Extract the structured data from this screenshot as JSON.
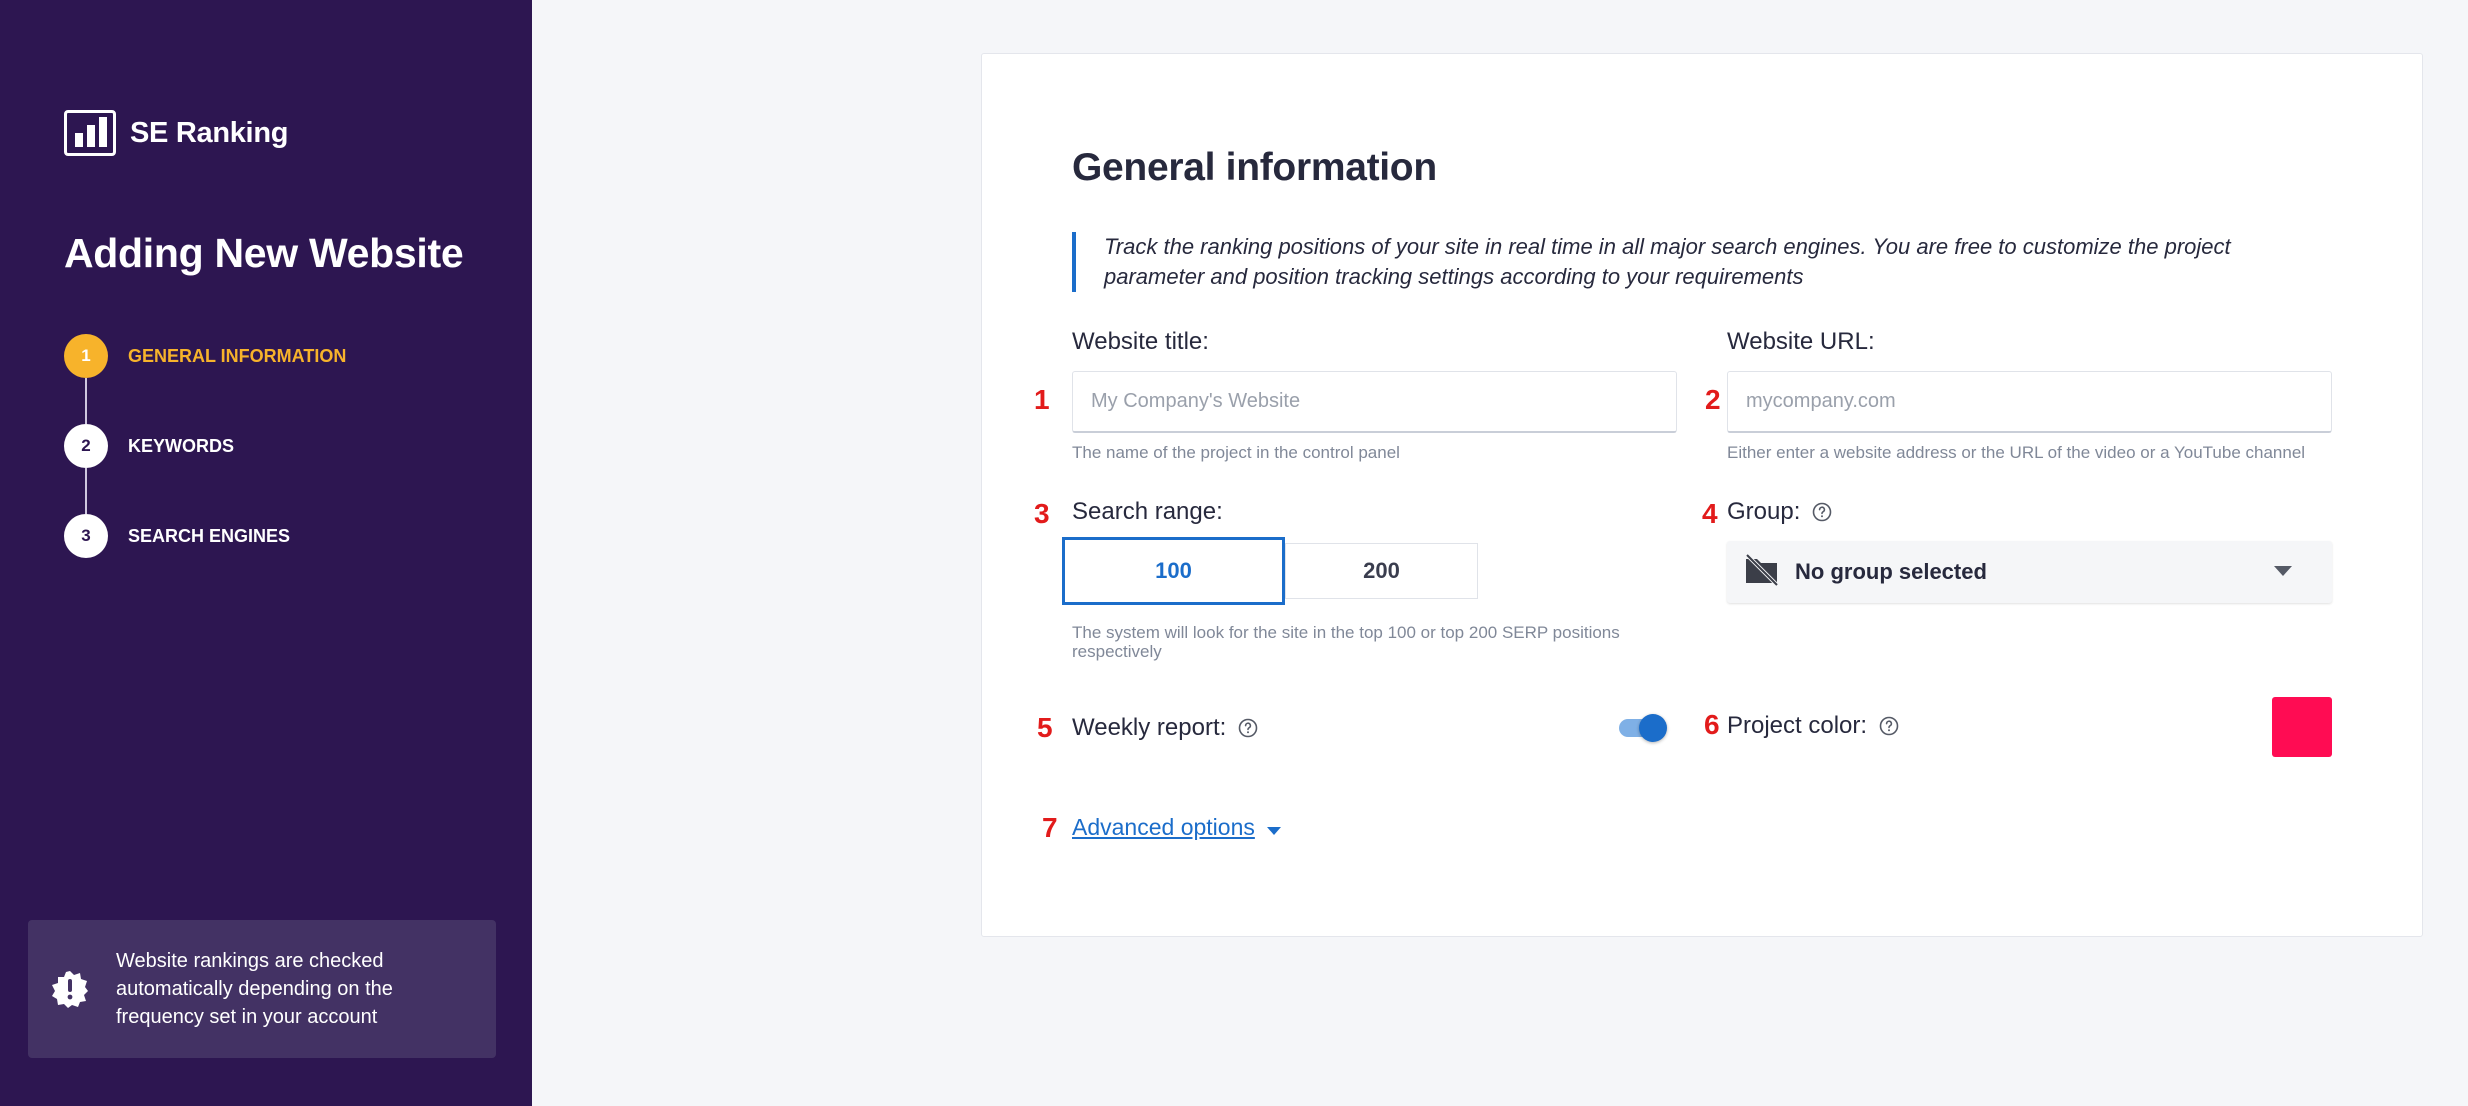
{
  "colors": {
    "sidebar_bg": "#2d1651",
    "accent": "#f7b32b",
    "primary": "#1b6dca",
    "marker": "#e21b1b",
    "project_color": "#ff0c53"
  },
  "sidebar": {
    "logo_text": "SE Ranking",
    "title": "Adding New Website",
    "steps": [
      {
        "num": "1",
        "label": "GENERAL INFORMATION",
        "active": true
      },
      {
        "num": "2",
        "label": "KEYWORDS",
        "active": false
      },
      {
        "num": "3",
        "label": "SEARCH ENGINES",
        "active": false
      }
    ],
    "notice": "Website rankings are checked automatically depending on the frequency set in your account",
    "notice_icon": "alert-badge-icon"
  },
  "form": {
    "title": "General information",
    "description": "Track the ranking positions of your site in real time in all major search engines. You are free to customize the project parameter and position tracking settings according to your requirements",
    "markers": [
      "1",
      "2",
      "3",
      "4",
      "5",
      "6",
      "7"
    ],
    "website_title": {
      "label": "Website title:",
      "placeholder": "My Company's Website",
      "value": "",
      "hint": "The name of the project in the control panel"
    },
    "website_url": {
      "label": "Website URL:",
      "placeholder": "mycompany.com",
      "value": "",
      "hint": "Either enter a website address or the URL of the video or a YouTube channel"
    },
    "search_range": {
      "label": "Search range:",
      "options": [
        "100",
        "200"
      ],
      "selected": "100",
      "hint": "The system will look for the site in the top 100 or top 200 SERP positions respectively"
    },
    "group": {
      "label": "Group:",
      "selected": "No group selected",
      "icon": "no-folder-icon"
    },
    "weekly_report": {
      "label": "Weekly report:",
      "enabled": true
    },
    "project_color": {
      "label": "Project color:",
      "value": "#ff0c53"
    },
    "advanced": {
      "label": "Advanced options"
    }
  }
}
